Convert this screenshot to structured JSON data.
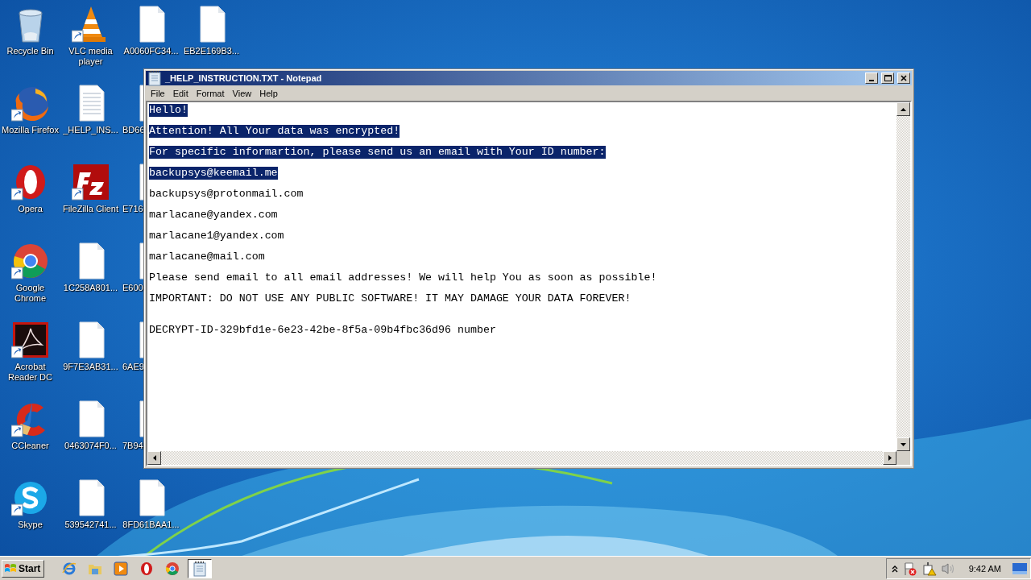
{
  "desktop_rows": [
    {
      "icons": [
        {
          "kind": "recycle-bin",
          "label": "Recycle Bin",
          "shortcut": false
        },
        {
          "kind": "vlc",
          "label": "VLC media player",
          "shortcut": true
        },
        {
          "kind": "file",
          "label": "A0060FC34...",
          "shortcut": false
        },
        {
          "kind": "file",
          "label": "EB2E169B3...",
          "shortcut": false
        }
      ]
    },
    {
      "icons": [
        {
          "kind": "firefox",
          "label": "Mozilla Firefox",
          "shortcut": true
        },
        {
          "kind": "text-file",
          "label": "_HELP_INS...",
          "shortcut": false
        },
        {
          "kind": "file",
          "label": "BD66",
          "shortcut": false,
          "cut": true
        }
      ]
    },
    {
      "icons": [
        {
          "kind": "opera",
          "label": "Opera",
          "shortcut": true
        },
        {
          "kind": "filezilla",
          "label": "FileZilla Client",
          "shortcut": true
        },
        {
          "kind": "file",
          "label": "E716",
          "shortcut": false,
          "cut": true
        }
      ]
    },
    {
      "icons": [
        {
          "kind": "chrome",
          "label": "Google Chrome",
          "shortcut": true
        },
        {
          "kind": "file",
          "label": "1C258A801...",
          "shortcut": false
        },
        {
          "kind": "file",
          "label": "E600",
          "shortcut": false,
          "cut": true
        }
      ]
    },
    {
      "icons": [
        {
          "kind": "acrobat",
          "label": "Acrobat Reader DC",
          "shortcut": true
        },
        {
          "kind": "file",
          "label": "9F7E3AB31...",
          "shortcut": false
        },
        {
          "kind": "file",
          "label": "6AE9",
          "shortcut": false,
          "cut": true
        }
      ]
    },
    {
      "icons": [
        {
          "kind": "ccleaner",
          "label": "CCleaner",
          "shortcut": true
        },
        {
          "kind": "file",
          "label": "0463074F0...",
          "shortcut": false
        },
        {
          "kind": "file",
          "label": "7B94",
          "shortcut": false,
          "cut": true
        }
      ]
    },
    {
      "icons": [
        {
          "kind": "skype",
          "label": "Skype",
          "shortcut": true
        },
        {
          "kind": "file",
          "label": "539542741...",
          "shortcut": false
        },
        {
          "kind": "file",
          "label": "8FD61BAA1...",
          "shortcut": false
        }
      ]
    }
  ],
  "window": {
    "title": "_HELP_INSTRUCTION.TXT - Notepad",
    "menu": [
      "File",
      "Edit",
      "Format",
      "View",
      "Help"
    ],
    "lines": [
      {
        "text": "Hello!",
        "selected": true
      },
      {
        "text": "Attention! All Your data was encrypted!",
        "selected": true
      },
      {
        "text": "For specific informartion, please send us an email with Your ID number:",
        "selected": true
      },
      {
        "text": "backupsys@keemail.me",
        "selected": true
      },
      {
        "text": "backupsys@protonmail.com",
        "selected": false
      },
      {
        "text": "marlacane@yandex.com",
        "selected": false
      },
      {
        "text": "marlacane1@yandex.com",
        "selected": false
      },
      {
        "text": "marlacane@mail.com",
        "selected": false
      },
      {
        "text": "Please send email to all email addresses! We will help You as soon as possible!",
        "selected": false
      },
      {
        "text": "IMPORTANT: DO NOT USE ANY PUBLIC SOFTWARE! IT MAY DAMAGE YOUR DATA FOREVER!",
        "selected": false
      },
      {
        "text": "DECRYPT-ID-329bfd1e-6e23-42be-8f5a-09b4fbc36d96 number",
        "selected": false,
        "blank_before": true
      }
    ]
  },
  "taskbar": {
    "start": "Start",
    "items": [
      {
        "kind": "ie",
        "active": false
      },
      {
        "kind": "folder",
        "active": false
      },
      {
        "kind": "media",
        "active": false
      },
      {
        "kind": "opera",
        "active": false
      },
      {
        "kind": "chrome",
        "active": false
      },
      {
        "kind": "notepad",
        "active": true
      }
    ],
    "tray": [
      {
        "kind": "chevron"
      },
      {
        "kind": "flag-error"
      },
      {
        "kind": "network-warning"
      },
      {
        "kind": "speaker"
      }
    ],
    "clock": "9:42 AM"
  }
}
